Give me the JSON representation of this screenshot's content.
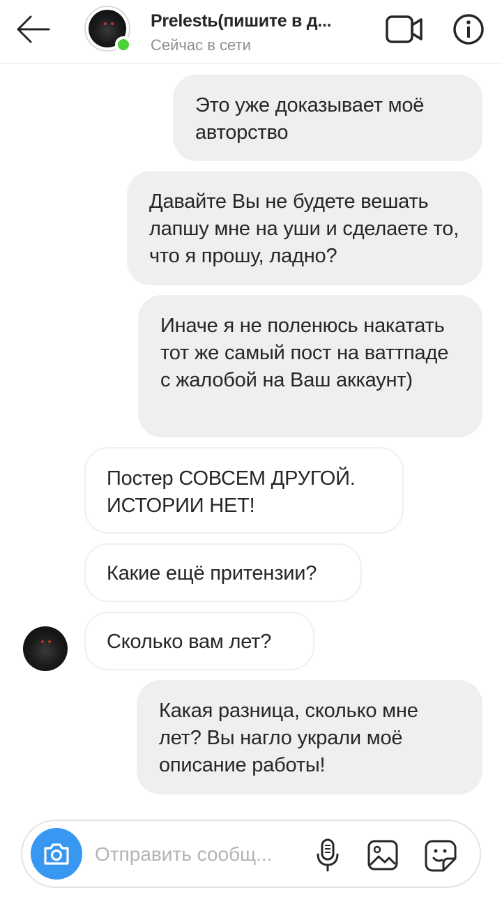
{
  "header": {
    "title": "Prelestь(пишите в д...",
    "status": "Сейчас в сети"
  },
  "messages": [
    {
      "direction": "out",
      "text": "Это уже доказывает моё авторство"
    },
    {
      "direction": "out",
      "text": "Давайте Вы не будете вешать лапшу мне на уши и сделаете то, что я прошу, ладно?"
    },
    {
      "direction": "out",
      "text": "Иначе я не поленюсь накатать тот же самый пост на ваттпаде с жалобой на Ваш аккаунт)"
    },
    {
      "direction": "in",
      "text": "Постер СОВСЕМ ДРУГОЙ. ИСТОРИИ НЕТ!"
    },
    {
      "direction": "in",
      "text": "Какие ещё притензии?"
    },
    {
      "direction": "in",
      "text": "Сколько вам лет?"
    },
    {
      "direction": "out",
      "text": "Какая разница, сколько мне лет? Вы нагло украли моё описание работы!"
    }
  ],
  "composer": {
    "placeholder": "Отправить сообщ..."
  },
  "icons": {
    "back": "arrow-left-icon",
    "video": "video-camera-icon",
    "info": "info-icon",
    "camera": "camera-icon",
    "mic": "microphone-icon",
    "gallery": "image-icon",
    "sticker": "sticker-icon"
  },
  "colors": {
    "accent": "#3897f0",
    "online": "#4cd137",
    "outgoing_bubble": "#efefef",
    "muted_text": "#8e8e8e"
  }
}
